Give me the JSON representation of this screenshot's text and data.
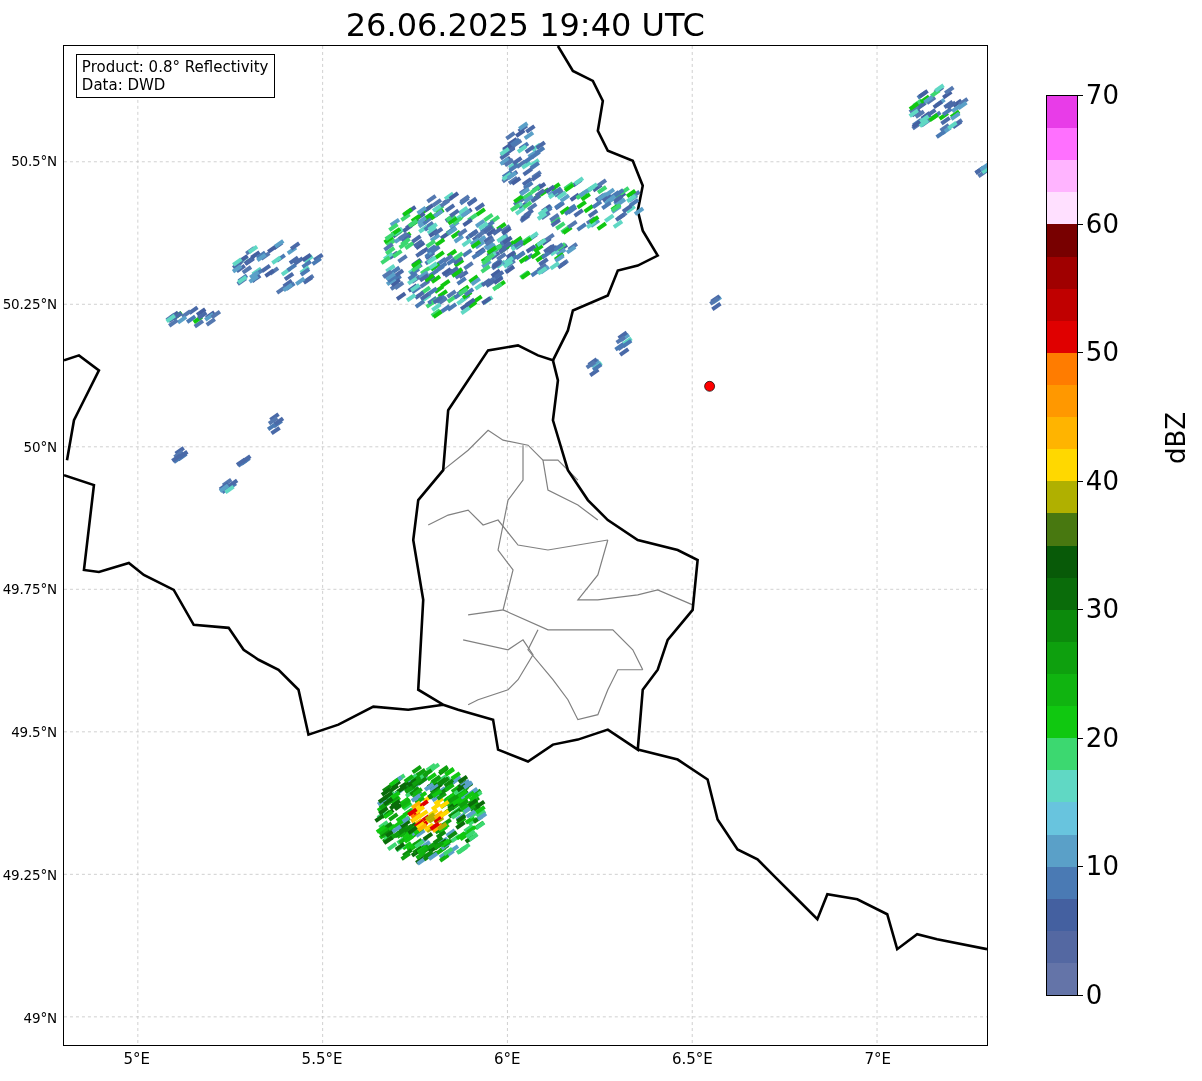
{
  "title": "26.06.2025 19:40 UTC",
  "info_box": {
    "lines": [
      "Product: 0.8° Reflectivity",
      "Data: DWD"
    ]
  },
  "map": {
    "y_ticks": [
      "50.5°N",
      "50.25°N",
      "50°N",
      "49.75°N",
      "49.5°N",
      "49.25°N",
      "49°N"
    ],
    "x_ticks": [
      "5°E",
      "5.5°E",
      "6°E",
      "6.5°E",
      "7°E"
    ]
  },
  "colorbar": {
    "label": "dBZ",
    "ticks": [
      "70",
      "60",
      "50",
      "40",
      "30",
      "20",
      "10",
      "0"
    ],
    "segments": [
      {
        "color": "#e83ce8"
      },
      {
        "color": "#ff70ff"
      },
      {
        "color": "#ffb4ff"
      },
      {
        "color": "#ffe0ff"
      },
      {
        "color": "#780000"
      },
      {
        "color": "#a00000"
      },
      {
        "color": "#c00000"
      },
      {
        "color": "#e00000"
      },
      {
        "color": "#ff7c00"
      },
      {
        "color": "#ff9800"
      },
      {
        "color": "#ffb400"
      },
      {
        "color": "#ffd800"
      },
      {
        "color": "#b0b000"
      },
      {
        "color": "#487810"
      },
      {
        "color": "#085a08"
      },
      {
        "color": "#0a6c0a"
      },
      {
        "color": "#0c8a0c"
      },
      {
        "color": "#0ea00e"
      },
      {
        "color": "#10b410"
      },
      {
        "color": "#10c810"
      },
      {
        "color": "#3cd870"
      },
      {
        "color": "#60d8c4"
      },
      {
        "color": "#68c4de"
      },
      {
        "color": "#5aa0c8"
      },
      {
        "color": "#4a7ab4"
      },
      {
        "color": "#4460a0"
      },
      {
        "color": "#5468a2"
      },
      {
        "color": "#6474a8"
      }
    ]
  }
}
